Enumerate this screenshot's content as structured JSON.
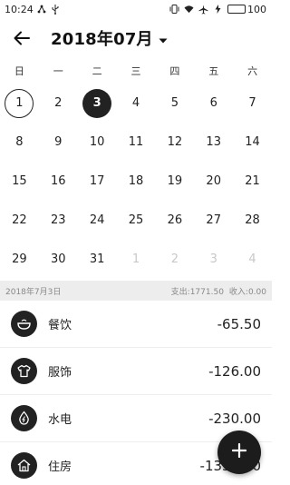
{
  "status_bar": {
    "time": "10:24",
    "battery": "100",
    "battery_level": 1.0
  },
  "header": {
    "title": "2018年07月"
  },
  "calendar": {
    "weekdays": [
      "日",
      "一",
      "二",
      "三",
      "四",
      "五",
      "六"
    ],
    "days": [
      {
        "label": "1",
        "state": "today"
      },
      {
        "label": "2",
        "state": "normal"
      },
      {
        "label": "3",
        "state": "selected"
      },
      {
        "label": "4",
        "state": "normal"
      },
      {
        "label": "5",
        "state": "normal"
      },
      {
        "label": "6",
        "state": "normal"
      },
      {
        "label": "7",
        "state": "normal"
      },
      {
        "label": "8",
        "state": "normal"
      },
      {
        "label": "9",
        "state": "normal"
      },
      {
        "label": "10",
        "state": "normal"
      },
      {
        "label": "11",
        "state": "normal"
      },
      {
        "label": "12",
        "state": "normal"
      },
      {
        "label": "13",
        "state": "normal"
      },
      {
        "label": "14",
        "state": "normal"
      },
      {
        "label": "15",
        "state": "normal"
      },
      {
        "label": "16",
        "state": "normal"
      },
      {
        "label": "17",
        "state": "normal"
      },
      {
        "label": "18",
        "state": "normal"
      },
      {
        "label": "19",
        "state": "normal"
      },
      {
        "label": "20",
        "state": "normal"
      },
      {
        "label": "21",
        "state": "normal"
      },
      {
        "label": "22",
        "state": "normal"
      },
      {
        "label": "23",
        "state": "normal"
      },
      {
        "label": "24",
        "state": "normal"
      },
      {
        "label": "25",
        "state": "normal"
      },
      {
        "label": "26",
        "state": "normal"
      },
      {
        "label": "27",
        "state": "normal"
      },
      {
        "label": "28",
        "state": "normal"
      },
      {
        "label": "29",
        "state": "normal"
      },
      {
        "label": "30",
        "state": "normal"
      },
      {
        "label": "31",
        "state": "normal"
      },
      {
        "label": "1",
        "state": "muted"
      },
      {
        "label": "2",
        "state": "muted"
      },
      {
        "label": "3",
        "state": "muted"
      },
      {
        "label": "4",
        "state": "muted"
      }
    ]
  },
  "summary": {
    "date": "2018年7月3日",
    "expense": "支出:1771.50",
    "income": "收入:0.00"
  },
  "entries": [
    {
      "name": "餐饮",
      "amount": "-65.50",
      "icon": "bowl-icon"
    },
    {
      "name": "服饰",
      "amount": "-126.00",
      "icon": "shirt-icon"
    },
    {
      "name": "水电",
      "amount": "-230.00",
      "icon": "water-drop-icon"
    },
    {
      "name": "住房",
      "amount": "-1350.00",
      "icon": "house-icon"
    }
  ],
  "colors": {
    "accent": "#222222",
    "muted": "#c8c8c8",
    "summary_bg": "#ededed"
  }
}
